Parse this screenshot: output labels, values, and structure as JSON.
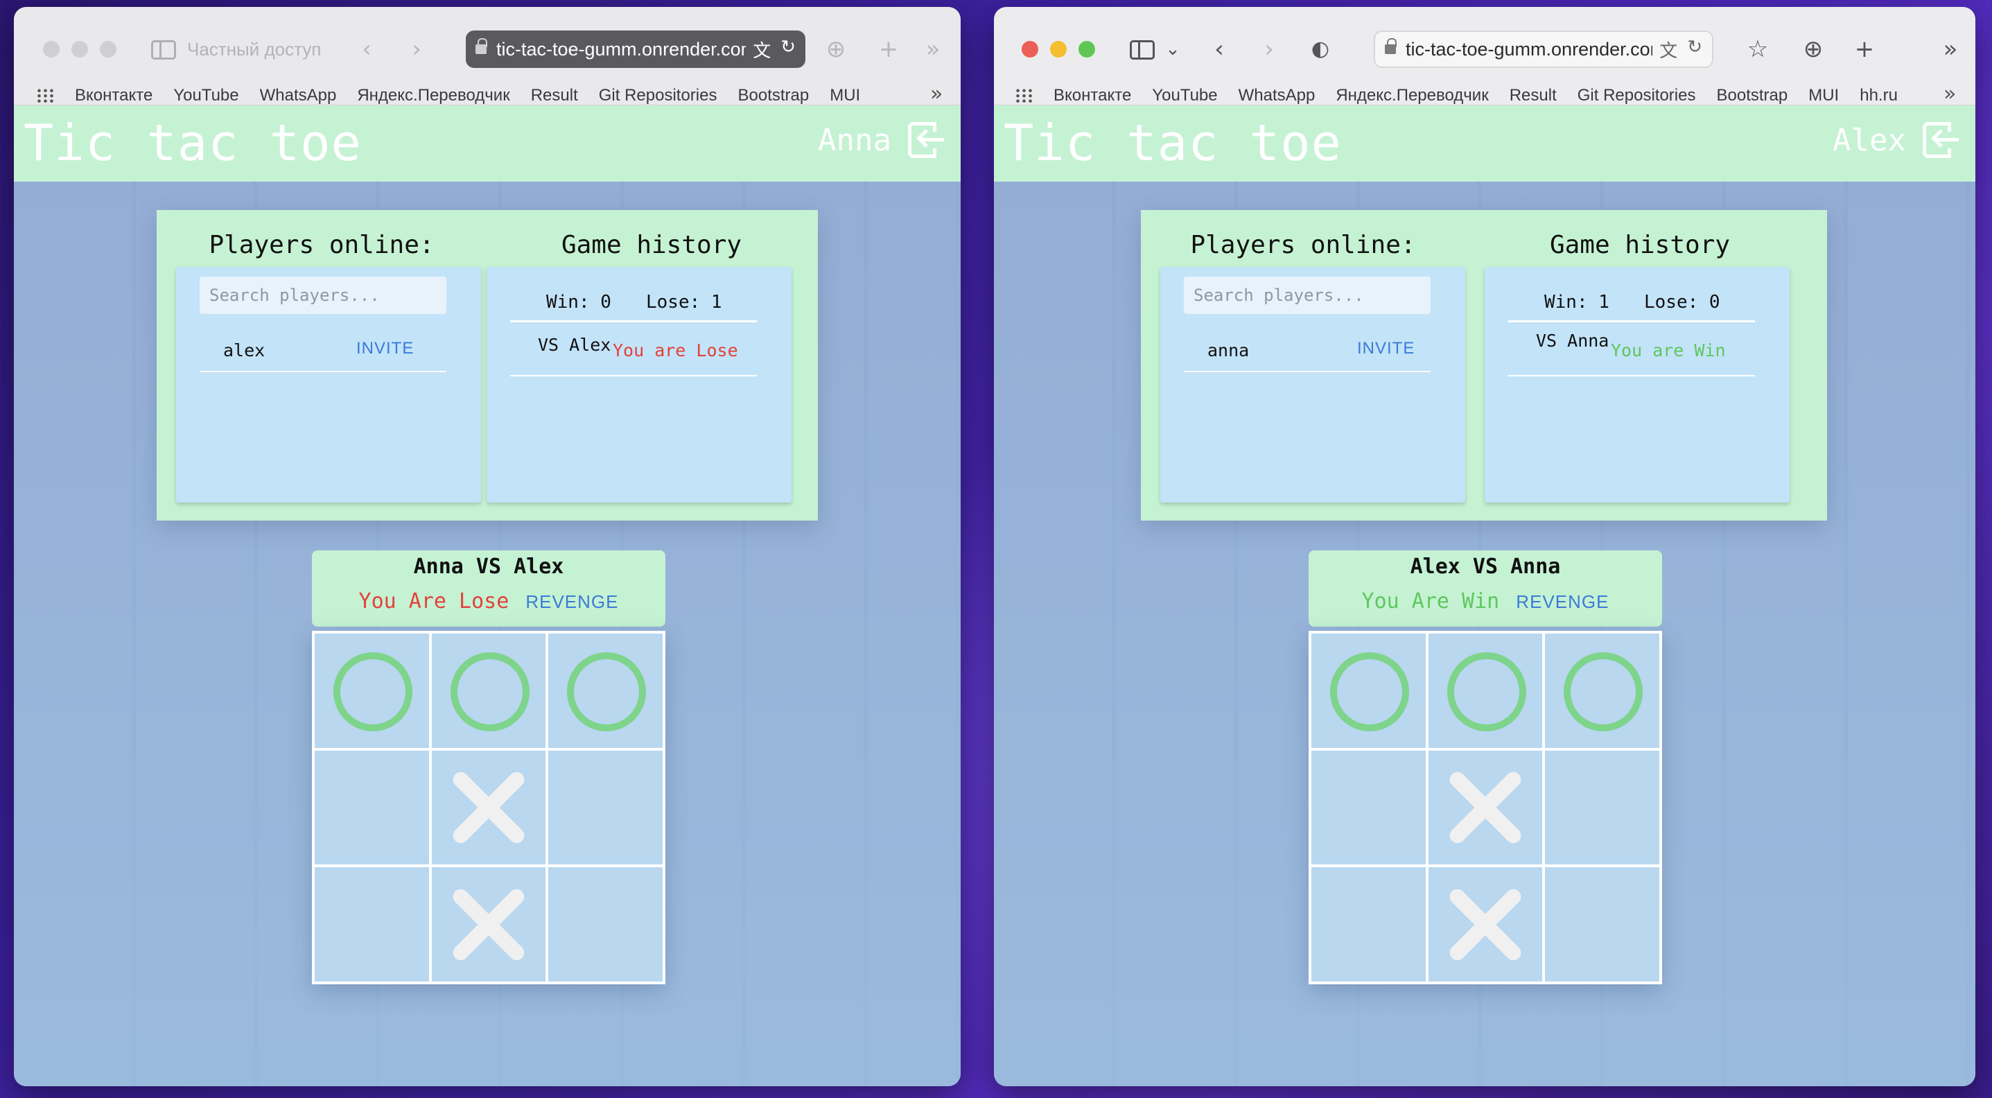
{
  "left": {
    "private_label": "Частный доступ",
    "url": "tic-tac-toe-gumm.onrender.com",
    "bookmarks": [
      "Вконтакте",
      "YouTube",
      "WhatsApp",
      "Яндекс.Переводчик",
      "Result",
      "Git Repositories",
      "Bootstrap",
      "MUI"
    ],
    "app_title": "Tic tac toe",
    "user": "Anna",
    "players_title": "Players online:",
    "search_placeholder": "Search players...",
    "players": [
      {
        "name": "alex",
        "action": "INVITE"
      }
    ],
    "history_title": "Game history",
    "win_label": "Win: 0",
    "lose_label": "Lose: 1",
    "history": [
      {
        "vs": "VS Alex",
        "result": "You are Lose"
      }
    ],
    "match_title": "Anna VS Alex",
    "match_result": "You Are Lose",
    "revenge": "REVENGE",
    "board": [
      "O",
      "O",
      "O",
      "",
      "X",
      "",
      "",
      "X",
      ""
    ]
  },
  "right": {
    "url": "tic-tac-toe-gumm.onrender.com",
    "bookmarks": [
      "Вконтакте",
      "YouTube",
      "WhatsApp",
      "Яндекс.Переводчик",
      "Result",
      "Git Repositories",
      "Bootstrap",
      "MUI",
      "hh.ru"
    ],
    "app_title": "Tic tac toe",
    "user": "Alex",
    "players_title": "Players online:",
    "search_placeholder": "Search players...",
    "players": [
      {
        "name": "anna",
        "action": "INVITE"
      }
    ],
    "history_title": "Game history",
    "win_label": "Win: 1",
    "lose_label": "Lose: 0",
    "history": [
      {
        "vs": "VS Anna",
        "result": "You are Win"
      }
    ],
    "match_title": "Alex VS Anna",
    "match_result": "You Are Win",
    "revenge": "REVENGE",
    "board": [
      "O",
      "O",
      "O",
      "",
      "X",
      "",
      "",
      "X",
      ""
    ]
  },
  "icons": {
    "back": "‹",
    "forward": "›",
    "download": "⊕",
    "new_tab": "+",
    "more": "»",
    "translate": "文",
    "reload": "↻",
    "shield": "◐",
    "star": "☆",
    "chevron_down": "⌄"
  },
  "colors": {
    "header_bg": "#c5f2d3",
    "panel_bg": "#c3e3f8",
    "lose": "#e2423a",
    "win": "#5ec75e",
    "link": "#3b7bd6",
    "o_mark": "#7ed48b",
    "x_mark": "#f0f0f0"
  }
}
